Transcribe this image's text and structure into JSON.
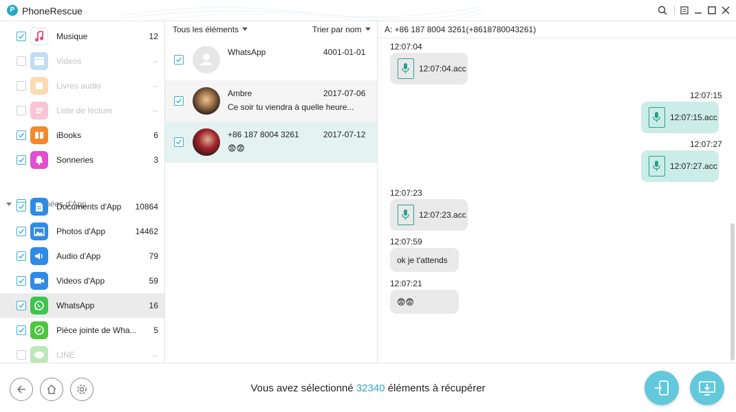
{
  "app": {
    "title": "PhoneRescue",
    "logo_letter": "P"
  },
  "sidebar": {
    "items": [
      {
        "label": "Musique",
        "count": "12"
      },
      {
        "label": "Videos",
        "count": "--"
      },
      {
        "label": "Livres audio",
        "count": "--"
      },
      {
        "label": "Liste de lecture",
        "count": "--"
      },
      {
        "label": "iBooks",
        "count": "6"
      },
      {
        "label": "Sonneries",
        "count": "3"
      },
      {
        "label": "Documents d'App",
        "count": "10864"
      },
      {
        "label": "Photos d'App",
        "count": "14462"
      },
      {
        "label": "Audio d'App",
        "count": "79"
      },
      {
        "label": "Videos d'App",
        "count": "59"
      },
      {
        "label": "WhatsApp",
        "count": "16"
      },
      {
        "label": "Pièce jointe de Wha...",
        "count": "5"
      },
      {
        "label": "LINE",
        "count": "--"
      }
    ],
    "section_label": "Données d'App"
  },
  "list": {
    "filter_label": "Tous les éléments",
    "sort_label": "Trier par nom",
    "conversations": [
      {
        "name": "WhatsApp",
        "date": "4001-01-01",
        "preview": ""
      },
      {
        "name": "Ambre",
        "date": "2017-07-06",
        "preview": "Ce soir tu viendra à quelle heure..."
      },
      {
        "name": "+86 187 8004 3261",
        "date": "2017-07-12",
        "preview": "😨😨"
      }
    ]
  },
  "chat": {
    "header": "A: +86 187 8004 3261(+8618780043261)",
    "messages": [
      {
        "time": "12:07:04",
        "text": "12:07:04.acc"
      },
      {
        "time": "12:07:15",
        "text": "12:07:15.acc"
      },
      {
        "time": "12:07:27",
        "text": "12:07:27.acc"
      },
      {
        "time": "12:07:23",
        "text": "12:07:23.acc"
      },
      {
        "time": "12:07:59",
        "text": "ok je t'attends"
      },
      {
        "time": "12:07:21",
        "text": "😨😨"
      }
    ]
  },
  "footer": {
    "status_prefix": "Vous avez sélectionné",
    "selected_count": "32340",
    "status_suffix": "éléments à récupérer"
  },
  "colors": {
    "accent": "#2fa9c2",
    "checkbox": "#3bb0c8",
    "bubble_out": "#ccece7",
    "bubble_in": "#e9e9e9",
    "recover_button": "#62c8dc"
  },
  "icons": [
    "phonerescue-logo-icon",
    "search-icon",
    "menu-icon",
    "minimize-icon",
    "maximize-icon",
    "close-icon",
    "back-icon",
    "home-icon",
    "settings-icon",
    "to-device-icon",
    "to-computer-icon",
    "audio-file-icon",
    "default-avatar-icon"
  ]
}
